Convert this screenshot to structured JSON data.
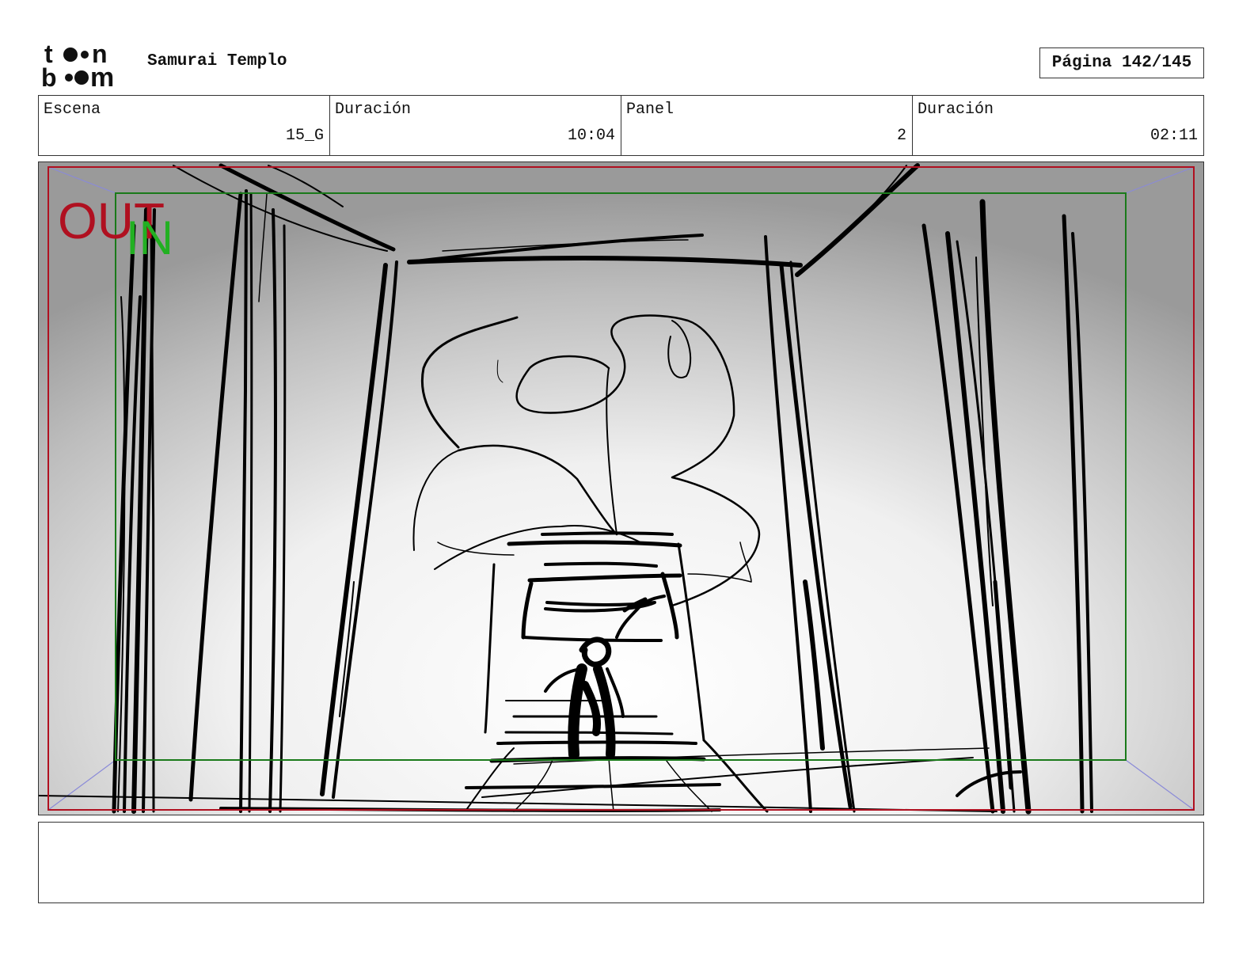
{
  "header": {
    "logo_top": "to•n",
    "logo_bottom": "b••m",
    "project_title": "Samurai Templo",
    "page_label": "Página 142/145"
  },
  "info": [
    {
      "label": "Escena",
      "value": "15_G"
    },
    {
      "label": "Duración",
      "value": "10:04"
    },
    {
      "label": "Panel",
      "value": "2"
    },
    {
      "label": "Duración",
      "value": "02:11"
    }
  ],
  "panel": {
    "out_label": "OUT",
    "in_label": "IN",
    "colors": {
      "out_frame": "#b01020",
      "in_frame": "#1a7a1a",
      "in_text": "#22b022",
      "corner_lines": "#8a8ad8",
      "ink": "#000000"
    }
  },
  "notes": {
    "text": ""
  }
}
